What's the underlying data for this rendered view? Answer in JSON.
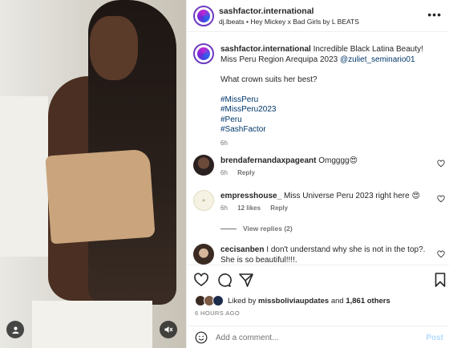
{
  "post": {
    "username": "sashfactor.international",
    "audio": "dj.lbeats • Hey Mickey x Bad Girls by L BEATS",
    "more": "•••"
  },
  "caption": {
    "username": "sashfactor.international",
    "line1": "Incredible Black Latina Beauty!",
    "line2_prefix": "Miss Peru Region Arequipa 2023 ",
    "line2_mention": "@zuliet_seminario01",
    "question": "What crown suits her best?",
    "hashtags": [
      "#MissPeru",
      "#MissPeru2023",
      "#Peru",
      "#SashFactor"
    ],
    "time": "6h"
  },
  "comments": [
    {
      "username": "brendafernandaxpageant",
      "text": "Omgggg😍",
      "time": "6h",
      "reply": "Reply"
    },
    {
      "username": "empresshouse_",
      "text": "Miss Universe Peru 2023 right here 😍",
      "time": "6h",
      "likes": "12 likes",
      "reply": "Reply",
      "view_replies": "View replies (2)"
    },
    {
      "username": "cecisanben",
      "text": "I don't understand why she is not in the top?. She is so beautiful!!!!."
    }
  ],
  "likes": {
    "prefix": "Liked by ",
    "user": "missboliviaupdates",
    "middle": " and ",
    "others": "1,861 others"
  },
  "timestamp": "6 HOURS AGO",
  "add_comment": {
    "placeholder": "Add a comment...",
    "post": "Post"
  },
  "colors": {
    "link": "#00376b",
    "muted": "#737373",
    "post_disabled": "#b3dbff",
    "brand_ring": "#6d3bbf"
  },
  "icons": [
    "user-tag-icon",
    "mute-icon",
    "heart-icon",
    "comment-icon",
    "share-icon",
    "bookmark-icon",
    "emoji-icon"
  ]
}
